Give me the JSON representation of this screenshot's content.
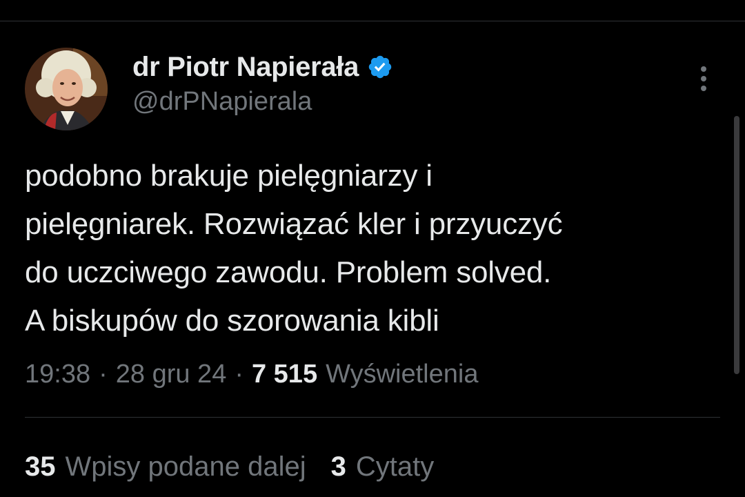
{
  "author": {
    "name": "dr Piotr Napierała",
    "handle": "@drPNapierala",
    "verified": true,
    "verified_color": "#1d9bf0",
    "avatar_icon": "profile-avatar-image"
  },
  "tweet": {
    "text_lines": [
      "podobno brakuje pielęgniarzy i",
      "pielęgniarek. Rozwiązać kler i przyuczyć",
      "do uczciwego zawodu. Problem solved.",
      "A biskupów do szorowania kibli"
    ]
  },
  "meta": {
    "time": "19:38",
    "separator": "·",
    "date": "28 gru 24",
    "views_count": "7 515",
    "views_label": "Wyświetlenia"
  },
  "stats": {
    "retweets_count": "35",
    "retweets_label": "Wpisy podane dalej",
    "quotes_count": "3",
    "quotes_label": "Cytaty"
  },
  "icons": {
    "more": "more-vertical-icon",
    "verified": "verified-badge-icon"
  },
  "colors": {
    "background": "#000000",
    "text_primary": "#e7e9ea",
    "text_secondary": "#71767b",
    "divider": "#2f3336"
  }
}
